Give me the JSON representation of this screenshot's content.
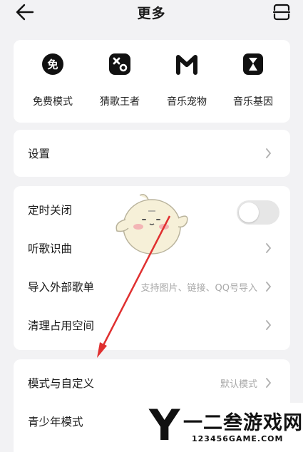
{
  "header": {
    "title": "更多",
    "back_icon": "arrow-left-icon",
    "scan_icon": "scan-icon"
  },
  "features": [
    {
      "label": "免费模式",
      "icon": "free-mode-icon",
      "glyph": "免"
    },
    {
      "label": "猜歌王者",
      "icon": "dice-icon"
    },
    {
      "label": "音乐宠物",
      "icon": "m-logo-icon"
    },
    {
      "label": "音乐基因",
      "icon": "hourglass-icon"
    }
  ],
  "settings": {
    "label": "设置"
  },
  "tools": {
    "timer_off": {
      "label": "定时关闭",
      "enabled": false
    },
    "song_recognition": {
      "label": "听歌识曲"
    },
    "import_playlist": {
      "label": "导入外部歌单",
      "hint": "支持图片、链接、QQ号导入"
    },
    "clean_space": {
      "label": "清理占用空间"
    }
  },
  "modes": {
    "mode_custom": {
      "label": "模式与自定义",
      "hint": "默认模式"
    },
    "teen_mode": {
      "label": "青少年模式"
    }
  },
  "watermark": {
    "letter": "Y",
    "brand": "一二叁游戏网",
    "url": "123456GAME.COM"
  },
  "colors": {
    "accent_arrow": "#e03030",
    "card_bg": "#ffffff",
    "page_bg": "#f2f2f4"
  }
}
